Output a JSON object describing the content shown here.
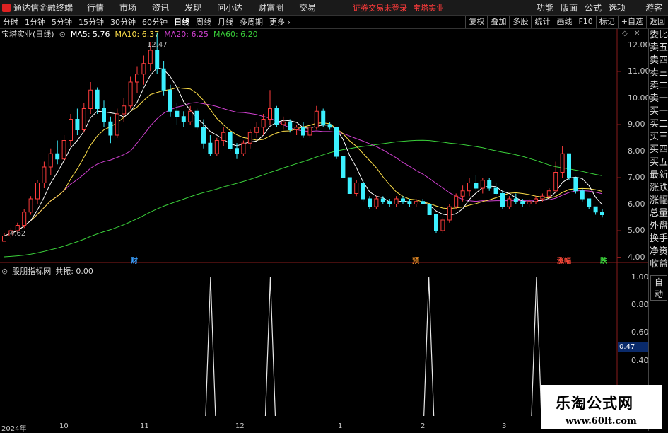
{
  "app": {
    "name": "通达信金融终端"
  },
  "menu": [
    "行情",
    "市场",
    "资讯",
    "发现",
    "问小达",
    "财富圈",
    "交易"
  ],
  "notice": {
    "unlogged": "证券交易未登录",
    "stock": "宝塔实业"
  },
  "right_menu": [
    "功能",
    "版面",
    "公式",
    "选项",
    "游客"
  ],
  "toolbar": {
    "periods": [
      "分时",
      "1分钟",
      "5分钟",
      "15分钟",
      "30分钟",
      "60分钟",
      "日线",
      "周线",
      "月线",
      "多周期",
      "更多"
    ],
    "active": "日线",
    "buttons": [
      "复权",
      "叠加",
      "多股",
      "统计",
      "画线",
      "F10",
      "标记",
      "+自选",
      "返回"
    ]
  },
  "chart_title": {
    "name": "宝塔实业(日线)",
    "ma5": "MA5: 5.76",
    "ma10": "MA10: 6.37",
    "ma20": "MA20: 6.25",
    "ma60": "MA60: 6.20"
  },
  "side_panel": [
    "委比",
    "卖五",
    "卖四",
    "卖三",
    "卖二",
    "卖一",
    "买一",
    "买二",
    "买三",
    "买四",
    "买五",
    "最新",
    "涨跌",
    "涨幅",
    "总量",
    "外盘",
    "换手",
    "净资",
    "收益"
  ],
  "side_auto": "自动",
  "price_axis": [
    "12.00",
    "11.00",
    "10.00",
    "9.00",
    "8.00",
    "7.00",
    "6.00",
    "5.00",
    "4.00"
  ],
  "price_annotations": {
    "high": "12.47",
    "low": "4.62"
  },
  "events": [
    {
      "label": "财",
      "color": "#3aa0ff"
    },
    {
      "label": "预",
      "color": "#ff9a2a"
    },
    {
      "label": "涨幅",
      "color": "#ff4a3a"
    },
    {
      "label": "跌",
      "color": "#3ad03a"
    }
  ],
  "indicator": {
    "name": "股朋指标网",
    "formula": "共振: 0.00",
    "axis": [
      "1.00",
      "0.80",
      "0.60",
      "0.40"
    ],
    "current": "0.47"
  },
  "date_axis": [
    "2024年",
    "10",
    "11",
    "12",
    "1",
    "2",
    "3"
  ],
  "watermark": {
    "title": "乐淘公式网",
    "url": "www.60lt.com"
  },
  "colors": {
    "up": "#ff3c3c",
    "down": "#3cf0ff",
    "ma5": "#ffffff",
    "ma10": "#ffe04a",
    "ma20": "#d040d0",
    "ma60": "#3ad03a"
  },
  "chart_data": {
    "type": "candlestick",
    "ylim": [
      3.8,
      12.6
    ],
    "candles": [
      [
        4.6,
        4.9,
        4.62,
        4.8
      ],
      [
        4.8,
        5.1,
        4.7,
        5.0
      ],
      [
        5.0,
        5.3,
        4.9,
        5.2
      ],
      [
        5.2,
        5.8,
        5.1,
        5.7
      ],
      [
        5.7,
        6.3,
        5.6,
        6.2
      ],
      [
        6.2,
        6.9,
        6.0,
        6.8
      ],
      [
        6.8,
        7.6,
        6.6,
        7.4
      ],
      [
        7.4,
        8.1,
        7.1,
        7.9
      ],
      [
        7.9,
        8.4,
        7.5,
        7.7
      ],
      [
        7.7,
        8.6,
        7.6,
        8.4
      ],
      [
        8.4,
        9.4,
        8.2,
        9.2
      ],
      [
        9.2,
        9.6,
        8.6,
        8.8
      ],
      [
        8.8,
        9.8,
        8.7,
        9.6
      ],
      [
        9.6,
        10.6,
        9.4,
        10.3
      ],
      [
        10.3,
        10.4,
        9.4,
        9.6
      ],
      [
        9.6,
        9.9,
        8.9,
        9.1
      ],
      [
        9.1,
        9.3,
        8.3,
        8.6
      ],
      [
        8.6,
        9.6,
        8.5,
        9.4
      ],
      [
        9.4,
        10.0,
        9.1,
        9.7
      ],
      [
        9.7,
        10.8,
        9.6,
        10.6
      ],
      [
        10.6,
        11.2,
        10.2,
        10.9
      ],
      [
        10.9,
        11.6,
        10.5,
        11.3
      ],
      [
        11.3,
        12.1,
        11.0,
        11.8
      ],
      [
        11.8,
        12.47,
        10.9,
        11.1
      ],
      [
        11.1,
        11.4,
        10.1,
        10.3
      ],
      [
        10.3,
        10.5,
        9.3,
        9.5
      ],
      [
        9.5,
        9.8,
        9.0,
        9.3
      ],
      [
        9.3,
        9.5,
        8.9,
        9.1
      ],
      [
        9.1,
        9.7,
        9.0,
        9.5
      ],
      [
        9.5,
        9.6,
        8.8,
        8.9
      ],
      [
        8.9,
        9.2,
        8.1,
        8.3
      ],
      [
        8.3,
        8.6,
        7.8,
        7.9
      ],
      [
        7.9,
        8.5,
        7.8,
        8.4
      ],
      [
        8.4,
        8.9,
        8.2,
        8.7
      ],
      [
        8.7,
        8.8,
        8.0,
        8.1
      ],
      [
        8.1,
        8.3,
        7.7,
        7.9
      ],
      [
        7.9,
        8.4,
        7.8,
        8.3
      ],
      [
        8.3,
        8.8,
        8.1,
        8.7
      ],
      [
        8.7,
        9.1,
        8.5,
        8.9
      ],
      [
        8.9,
        9.4,
        8.6,
        9.2
      ],
      [
        9.2,
        10.3,
        9.0,
        9.6
      ],
      [
        9.6,
        9.7,
        8.9,
        9.0
      ],
      [
        9.0,
        9.3,
        8.8,
        9.1
      ],
      [
        9.1,
        9.2,
        8.7,
        8.8
      ],
      [
        8.8,
        9.0,
        8.6,
        8.9
      ],
      [
        8.9,
        9.1,
        8.5,
        8.6
      ],
      [
        8.6,
        9.0,
        8.5,
        8.9
      ],
      [
        8.9,
        9.7,
        8.8,
        9.5
      ],
      [
        9.5,
        9.6,
        8.9,
        9.0
      ],
      [
        9.0,
        9.1,
        8.8,
        8.9
      ],
      [
        8.9,
        8.9,
        7.7,
        7.8
      ],
      [
        7.8,
        7.8,
        7.0,
        7.0
      ],
      [
        7.0,
        7.0,
        6.4,
        6.4
      ],
      [
        6.4,
        6.9,
        6.3,
        6.8
      ],
      [
        6.8,
        6.9,
        6.1,
        6.2
      ],
      [
        6.2,
        6.3,
        5.8,
        5.9
      ],
      [
        5.9,
        6.3,
        5.8,
        6.2
      ],
      [
        6.2,
        6.3,
        6.0,
        6.1
      ],
      [
        6.1,
        6.2,
        5.9,
        6.0
      ],
      [
        6.0,
        6.3,
        5.9,
        6.2
      ],
      [
        6.2,
        6.3,
        6.0,
        6.1
      ],
      [
        6.1,
        6.2,
        5.9,
        6.0
      ],
      [
        6.0,
        6.2,
        5.9,
        6.1
      ],
      [
        6.1,
        6.2,
        6.0,
        6.0
      ],
      [
        6.0,
        6.0,
        5.6,
        5.6
      ],
      [
        5.6,
        5.6,
        4.9,
        5.0
      ],
      [
        5.0,
        5.5,
        4.9,
        5.4
      ],
      [
        5.4,
        6.0,
        5.3,
        5.9
      ],
      [
        5.9,
        6.4,
        5.8,
        6.3
      ],
      [
        6.3,
        6.7,
        6.1,
        6.5
      ],
      [
        6.5,
        7.0,
        6.3,
        6.8
      ],
      [
        6.8,
        7.1,
        6.5,
        6.6
      ],
      [
        6.6,
        7.0,
        6.4,
        6.9
      ],
      [
        6.9,
        7.0,
        6.5,
        6.6
      ],
      [
        6.6,
        6.8,
        6.3,
        6.4
      ],
      [
        6.4,
        6.5,
        5.8,
        5.9
      ],
      [
        5.9,
        6.3,
        5.8,
        6.2
      ],
      [
        6.2,
        6.4,
        6.0,
        6.1
      ],
      [
        6.1,
        6.2,
        5.9,
        6.0
      ],
      [
        6.0,
        6.2,
        5.9,
        6.1
      ],
      [
        6.1,
        6.3,
        6.0,
        6.2
      ],
      [
        6.2,
        6.4,
        6.1,
        6.3
      ],
      [
        6.3,
        6.6,
        6.2,
        6.5
      ],
      [
        6.5,
        7.6,
        6.4,
        7.2
      ],
      [
        7.2,
        8.2,
        7.0,
        7.9
      ],
      [
        7.9,
        7.9,
        6.9,
        7.0
      ],
      [
        7.0,
        7.0,
        6.4,
        6.5
      ],
      [
        6.5,
        6.6,
        6.1,
        6.2
      ],
      [
        6.2,
        6.2,
        5.8,
        5.9
      ],
      [
        5.9,
        5.9,
        5.6,
        5.7
      ],
      [
        5.7,
        5.8,
        5.5,
        5.6
      ]
    ],
    "peaks": [
      0.345,
      0.445,
      0.71,
      0.89
    ]
  }
}
